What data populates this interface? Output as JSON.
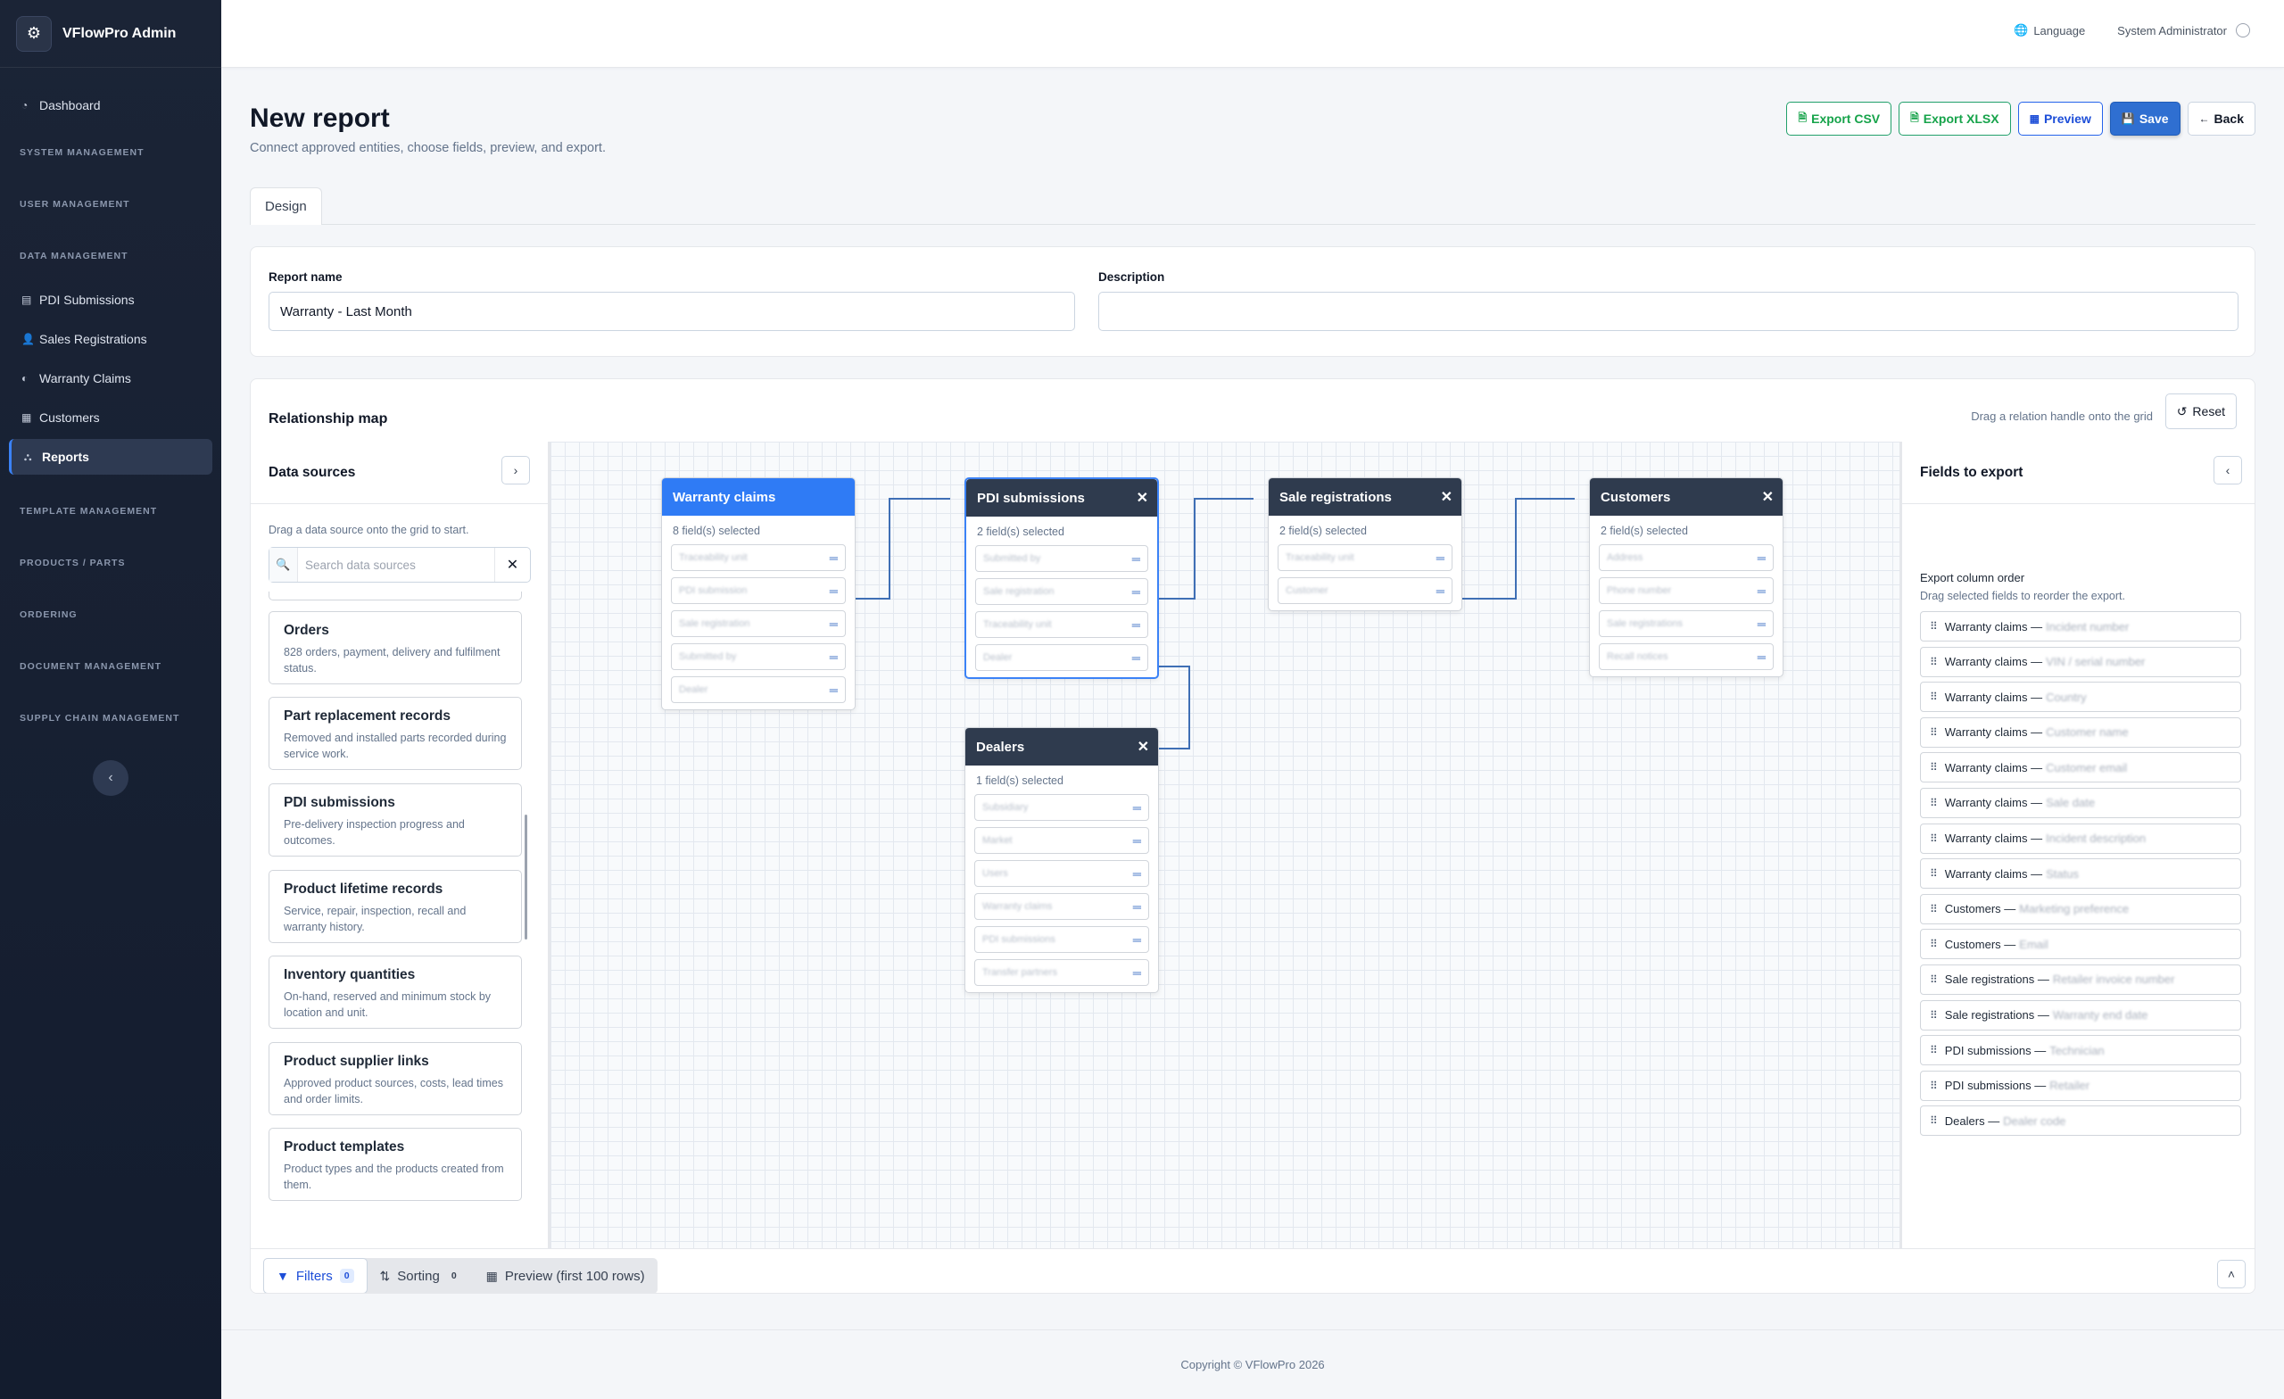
{
  "app": {
    "name": "VFlowPro Admin",
    "logo_icon": "gears-icon"
  },
  "topbar": {
    "language": "Language",
    "user": "System Administrator"
  },
  "nav": {
    "dashboard": "Dashboard",
    "system_management": "SYSTEM MANAGEMENT",
    "user_management": "USER MANAGEMENT",
    "data_management": "DATA MANAGEMENT",
    "pdi_submissions": "PDI Submissions",
    "sales_registrations": "Sales Registrations",
    "warranty_claims": "Warranty Claims",
    "customers": "Customers",
    "reports": "Reports",
    "template_management": "TEMPLATE MANAGEMENT",
    "products_parts": "PRODUCTS / PARTS",
    "ordering": "ORDERING",
    "document_management": "DOCUMENT MANAGEMENT",
    "supply_chain_management": "SUPPLY CHAIN MANAGEMENT"
  },
  "page": {
    "title": "New report",
    "subtitle": "Connect approved entities, choose fields, preview, and export."
  },
  "actions": {
    "export_csv": "Export CSV",
    "export_xlsx": "Export XLSX",
    "preview": "Preview",
    "save": "Save",
    "back": "Back"
  },
  "tabs": {
    "design": "Design"
  },
  "form": {
    "report_name_label": "Report name",
    "report_name_value": "Warranty - Last Month",
    "description_label": "Description",
    "description_value": ""
  },
  "relationship_map": {
    "title": "Relationship map",
    "hint": "Drag a relation handle onto the grid",
    "reset": "Reset"
  },
  "data_sources": {
    "title": "Data sources",
    "hint": "Drag a data source onto the grid to start.",
    "search_placeholder": "Search data sources",
    "items": [
      {
        "name": "Orders",
        "desc": "828 orders, payment, delivery and fulfilment status."
      },
      {
        "name": "Part replacement records",
        "desc": "Removed and installed parts recorded during service work."
      },
      {
        "name": "PDI submissions",
        "desc": "Pre-delivery inspection progress and outcomes."
      },
      {
        "name": "Product lifetime records",
        "desc": "Service, repair, inspection, recall and warranty history."
      },
      {
        "name": "Inventory quantities",
        "desc": "On-hand, reserved and minimum stock by location and unit."
      },
      {
        "name": "Product supplier links",
        "desc": "Approved product sources, costs, lead times and order limits."
      },
      {
        "name": "Product templates",
        "desc": "Product types and the products created from them."
      }
    ]
  },
  "entities": {
    "warranty": {
      "name": "Warranty claims",
      "count": "8 field(s) selected",
      "fields": [
        "Traceability unit",
        "PDI submission",
        "Sale registration",
        "Submitted by",
        "Dealer"
      ]
    },
    "pdi": {
      "name": "PDI submissions",
      "count": "2 field(s) selected",
      "fields": [
        "Submitted by",
        "Sale registration",
        "Traceability unit",
        "Dealer"
      ]
    },
    "sale": {
      "name": "Sale registrations",
      "count": "2 field(s) selected",
      "fields": [
        "Traceability unit",
        "Customer"
      ]
    },
    "customers": {
      "name": "Customers",
      "count": "2 field(s) selected",
      "fields": [
        "Address",
        "Phone number",
        "Sale registrations",
        "Recall notices"
      ]
    },
    "dealers": {
      "name": "Dealers",
      "count": "1 field(s) selected",
      "fields": [
        "Subsidiary",
        "Market",
        "Users",
        "Warranty claims",
        "PDI submissions",
        "Transfer partners"
      ]
    }
  },
  "fields_to_export": {
    "title": "Fields to export",
    "order_label": "Export column order",
    "order_hint": "Drag selected fields to reorder the export.",
    "items": [
      {
        "entity": "Warranty claims",
        "field": "Incident number"
      },
      {
        "entity": "Warranty claims",
        "field": "VIN / serial number"
      },
      {
        "entity": "Warranty claims",
        "field": "Country"
      },
      {
        "entity": "Warranty claims",
        "field": "Customer name"
      },
      {
        "entity": "Warranty claims",
        "field": "Customer email"
      },
      {
        "entity": "Warranty claims",
        "field": "Sale date"
      },
      {
        "entity": "Warranty claims",
        "field": "Incident description"
      },
      {
        "entity": "Warranty claims",
        "field": "Status"
      },
      {
        "entity": "Customers",
        "field": "Marketing preference"
      },
      {
        "entity": "Customers",
        "field": "Email"
      },
      {
        "entity": "Sale registrations",
        "field": "Retailer invoice number"
      },
      {
        "entity": "Sale registrations",
        "field": "Warranty end date"
      },
      {
        "entity": "PDI submissions",
        "field": "Technician"
      },
      {
        "entity": "PDI submissions",
        "field": "Retailer"
      },
      {
        "entity": "Dealers",
        "field": "Dealer code"
      }
    ]
  },
  "bottom": {
    "filters": "Filters",
    "filters_count": "0",
    "sorting": "Sorting",
    "sorting_count": "0",
    "preview": "Preview (first 100 rows)"
  },
  "footer": {
    "copyright": "Copyright © VFlowPro 2026"
  },
  "colors": {
    "accent": "#2f7bf5",
    "sidebar": "#1b2436",
    "export_green": "#16a34a",
    "entity_header": "#2f3b4e"
  }
}
